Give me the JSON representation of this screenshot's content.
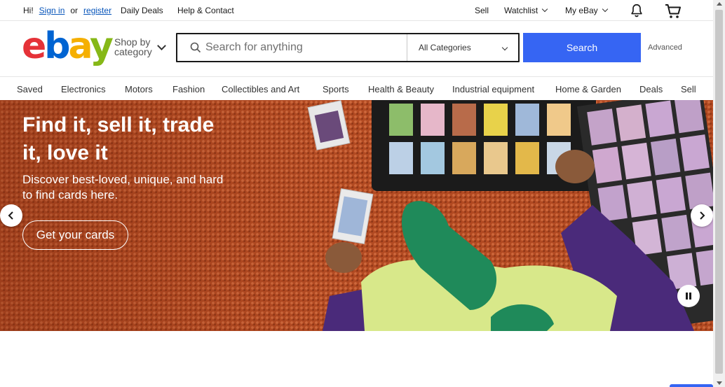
{
  "topbar": {
    "greeting": "Hi!",
    "sign_in": "Sign in",
    "or": "or",
    "register": "register",
    "daily_deals": "Daily Deals",
    "help_contact": "Help & Contact",
    "sell": "Sell",
    "watchlist": "Watchlist",
    "my_ebay": "My eBay",
    "notification_icon": "bell-icon",
    "cart_icon": "cart-icon"
  },
  "header": {
    "logo": {
      "e": "e",
      "b": "b",
      "a": "a",
      "y": "y"
    },
    "shop_by_line1": "Shop by",
    "shop_by_line2": "category",
    "search": {
      "placeholder": "Search for anything",
      "value": "",
      "category_selected": "All Categories",
      "button_label": "Search"
    },
    "advanced": "Advanced"
  },
  "nav": {
    "items": [
      "Saved",
      "Electronics",
      "Motors",
      "Fashion",
      "Collectibles and Art",
      "Sports",
      "Health & Beauty",
      "Industrial equipment",
      "Home & Garden",
      "Deals",
      "Sell"
    ]
  },
  "hero": {
    "title": "Find it, sell it, trade it, love it",
    "subtitle": "Discover best-loved, unique, and hard to find cards here.",
    "cta": "Get your cards"
  },
  "colors": {
    "accent": "#3665f3",
    "link": "#0654ba",
    "hero_bg": "#b24a22",
    "logo_red": "#e53238",
    "logo_blue": "#0064d2",
    "logo_yellow": "#f5af02",
    "logo_green": "#86b817"
  }
}
